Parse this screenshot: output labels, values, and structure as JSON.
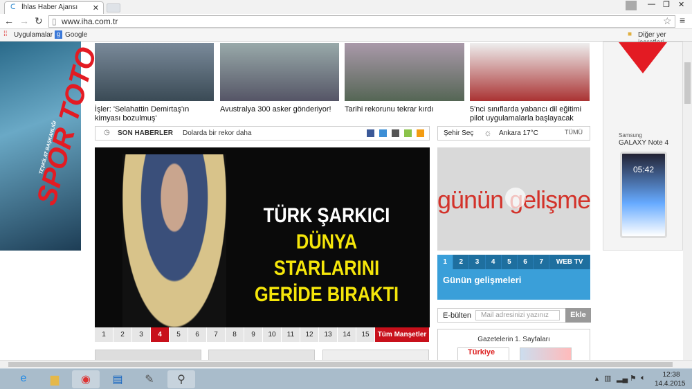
{
  "browser": {
    "tab_title": "İhlas Haber Ajansı",
    "url": "www.iha.com.tr",
    "bookmarks": [
      "Uygulamalar",
      "Google"
    ],
    "other_bookmarks": "Diğer yer işaretleri"
  },
  "ads": {
    "left_brand": "SPOR TOTO",
    "left_sub": "TEŞKİLAT BAŞKANLIĞI",
    "right_brand": "Samsung",
    "right_model": "GALAXY Note 4",
    "right_time": "05:42"
  },
  "top_news": [
    "İşler: 'Selahattin Demirtaş'ın kimyası bozulmuş'",
    "Avustralya 300 asker gönderiyor!",
    "Tarihi rekorunu tekrar kırdı",
    "5'nci sınıflarda yabancı dil eğitimi pilot uygulamalarla başlayacak"
  ],
  "son_haberler": {
    "label": "SON HABERLER",
    "headline": "Dolarda bir rekor daha"
  },
  "weather": {
    "city_select": "Şehir Seç",
    "current": "Ankara 17°C",
    "all": "TÜMÜ"
  },
  "slider": {
    "headline_lines": [
      "TÜRK ŞARKICI",
      "DÜNYA STARLARINI",
      "GERİDE BIRAKTI"
    ],
    "pages": [
      "1",
      "2",
      "3",
      "4",
      "5",
      "6",
      "7",
      "8",
      "9",
      "10",
      "11",
      "12",
      "13",
      "14",
      "15"
    ],
    "active_page": "4",
    "all_label": "Tüm Manşetler"
  },
  "video": {
    "overlay": "günün gelişmeleri",
    "tabs": [
      "1",
      "2",
      "3",
      "4",
      "5",
      "6",
      "7",
      "WEB TV"
    ],
    "title": "Günün gelişmeleri"
  },
  "newsletter": {
    "label": "E-bülten",
    "placeholder": "Mail adresinizi yazınız",
    "button": "Ekle"
  },
  "newspapers": {
    "title": "Gazetelerin 1. Sayfaları",
    "first": "Türkiye"
  },
  "taskbar": {
    "time": "12:38",
    "date": "14.4.2015"
  }
}
